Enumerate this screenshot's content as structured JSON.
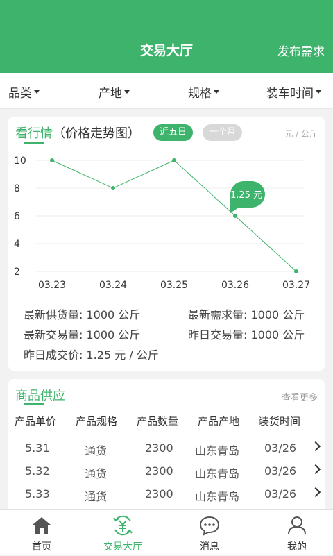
{
  "colors": {
    "primary": "#3db36b",
    "pill_inactive": "#d8d8d8"
  },
  "header": {
    "title": "交易大厅",
    "action": "发布需求"
  },
  "filters": [
    {
      "label": "品类",
      "icon": "caret-down-icon"
    },
    {
      "label": "产地",
      "icon": "caret-down-icon"
    },
    {
      "label": "规格",
      "icon": "caret-down-icon"
    },
    {
      "label": "装车时间",
      "icon": "caret-down-icon"
    }
  ],
  "market": {
    "title": "看行情",
    "subtitle": "（价格走势图）",
    "ranges": [
      "近五日",
      "一个月"
    ],
    "selected_range": "近五日",
    "unit": "元 / 公斤"
  },
  "chart_data": {
    "type": "line",
    "categories": [
      "03.23",
      "03.24",
      "03.25",
      "03.26",
      "03.27"
    ],
    "values": [
      10,
      8,
      10,
      6,
      2
    ],
    "yticks": [
      2,
      4,
      6,
      8,
      10
    ],
    "ylim": [
      1,
      11
    ],
    "grid": true,
    "highlight": {
      "index": 3,
      "label": "1.25 元"
    },
    "line_color": "#3db36b"
  },
  "stats": {
    "supply_label": "最新供货量:",
    "supply_value": "1000 公斤",
    "demand_label": "最新需求量:",
    "demand_value": "1000 公斤",
    "trade_label": "最新交易量:",
    "trade_value": "1000 公斤",
    "yesterday_trade_label": "昨日交易量:",
    "yesterday_trade_value": "1000 公斤",
    "yesterday_price_label": "昨日成交价:",
    "yesterday_price_value": "1.25 元 / 公斤"
  },
  "supply": {
    "title": "商品供应",
    "more": "查看更多",
    "columns": [
      "产品单价",
      "产品规格",
      "产品数量",
      "产品产地",
      "装货时间"
    ],
    "rows": [
      [
        "5.31",
        "通货",
        "2300",
        "山东青岛",
        "03/26"
      ],
      [
        "5.32",
        "通货",
        "2300",
        "山东青岛",
        "03/26"
      ],
      [
        "5.33",
        "通货",
        "2300",
        "山东青岛",
        "03/26"
      ]
    ]
  },
  "tabs": [
    {
      "label": "首页",
      "icon": "home-icon"
    },
    {
      "label": "交易大厅",
      "icon": "yuan-exchange-icon",
      "active": true
    },
    {
      "label": "消息",
      "icon": "message-icon"
    },
    {
      "label": "我的",
      "icon": "user-icon"
    }
  ]
}
